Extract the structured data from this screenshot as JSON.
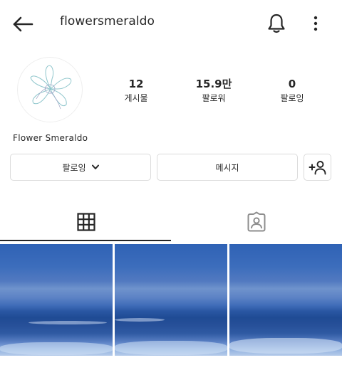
{
  "header": {
    "username": "flowersmeraldo"
  },
  "profile": {
    "display_name": "Flower Smeraldo"
  },
  "stats": [
    {
      "value": "12",
      "label": "게시물"
    },
    {
      "value": "15.9만",
      "label": "팔로워"
    },
    {
      "value": "0",
      "label": "팔로잉"
    }
  ],
  "actions": {
    "following_label": "팔로잉",
    "message_label": "메시지"
  },
  "icons": {
    "back": "arrow-left-icon",
    "notifications": "bell-icon",
    "more": "more-vertical-icon",
    "dropdown": "chevron-down-icon",
    "suggest": "add-person-icon",
    "grid_tab": "grid-icon",
    "tagged_tab": "tagged-person-icon"
  },
  "posts": [
    "sea-photo",
    "sea-photo",
    "sea-photo"
  ]
}
